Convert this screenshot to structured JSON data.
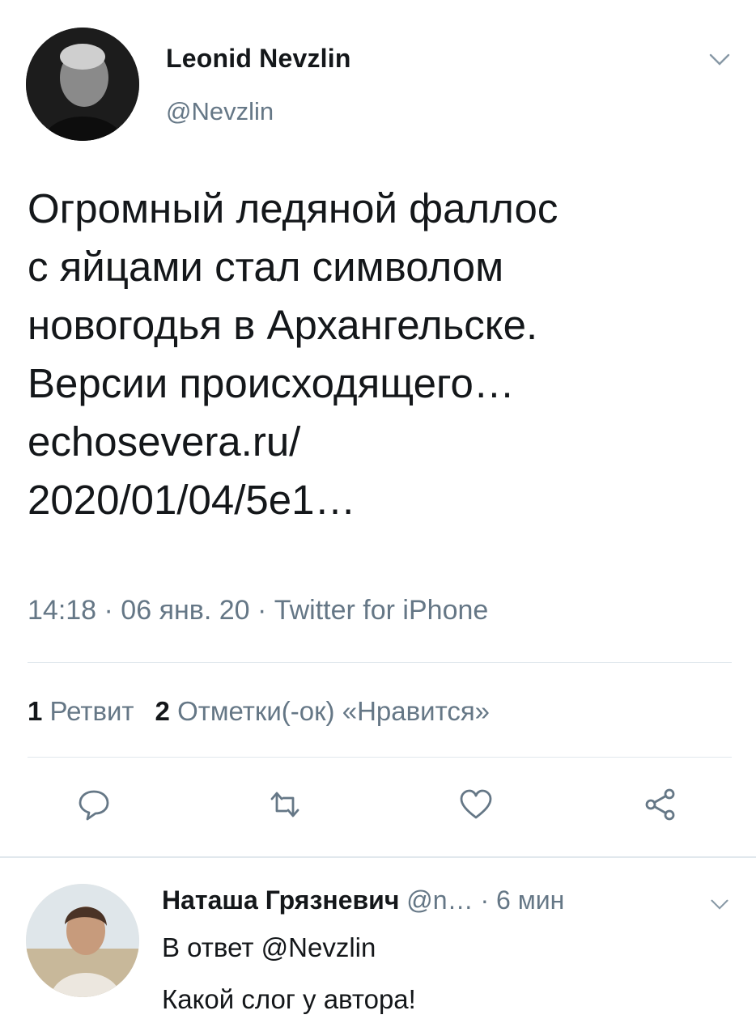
{
  "tweet": {
    "author_name": "Leonid Nevzlin",
    "author_handle": "@Nevzlin",
    "text": "Огромный ледяной фаллос\nс яйцами стал символом\nновогодья в Архангельске.\nВерсии происходящего…\nechosevera.ru/\n2020/01/04/5e1…",
    "meta": "14:18 · 06 янв. 20 · Twitter for iPhone",
    "retweet_count": "1",
    "retweet_label": "Ретвит",
    "like_count": "2",
    "like_label": "Отметки(-ок) «Нравится»"
  },
  "actions": {
    "reply": "reply-icon",
    "retweet": "retweet-icon",
    "like": "heart-icon",
    "share": "share-icon"
  },
  "reply": {
    "author_name": "Наташа Грязневич",
    "author_handle": "@n…",
    "time": "· 6 мин",
    "replying_prefix": "В ответ",
    "replying_to": "@Nevzlin",
    "text": "Какой слог у автора!"
  },
  "colors": {
    "text": "#14171a",
    "muted": "#657786",
    "divider": "#e1e8ed"
  }
}
